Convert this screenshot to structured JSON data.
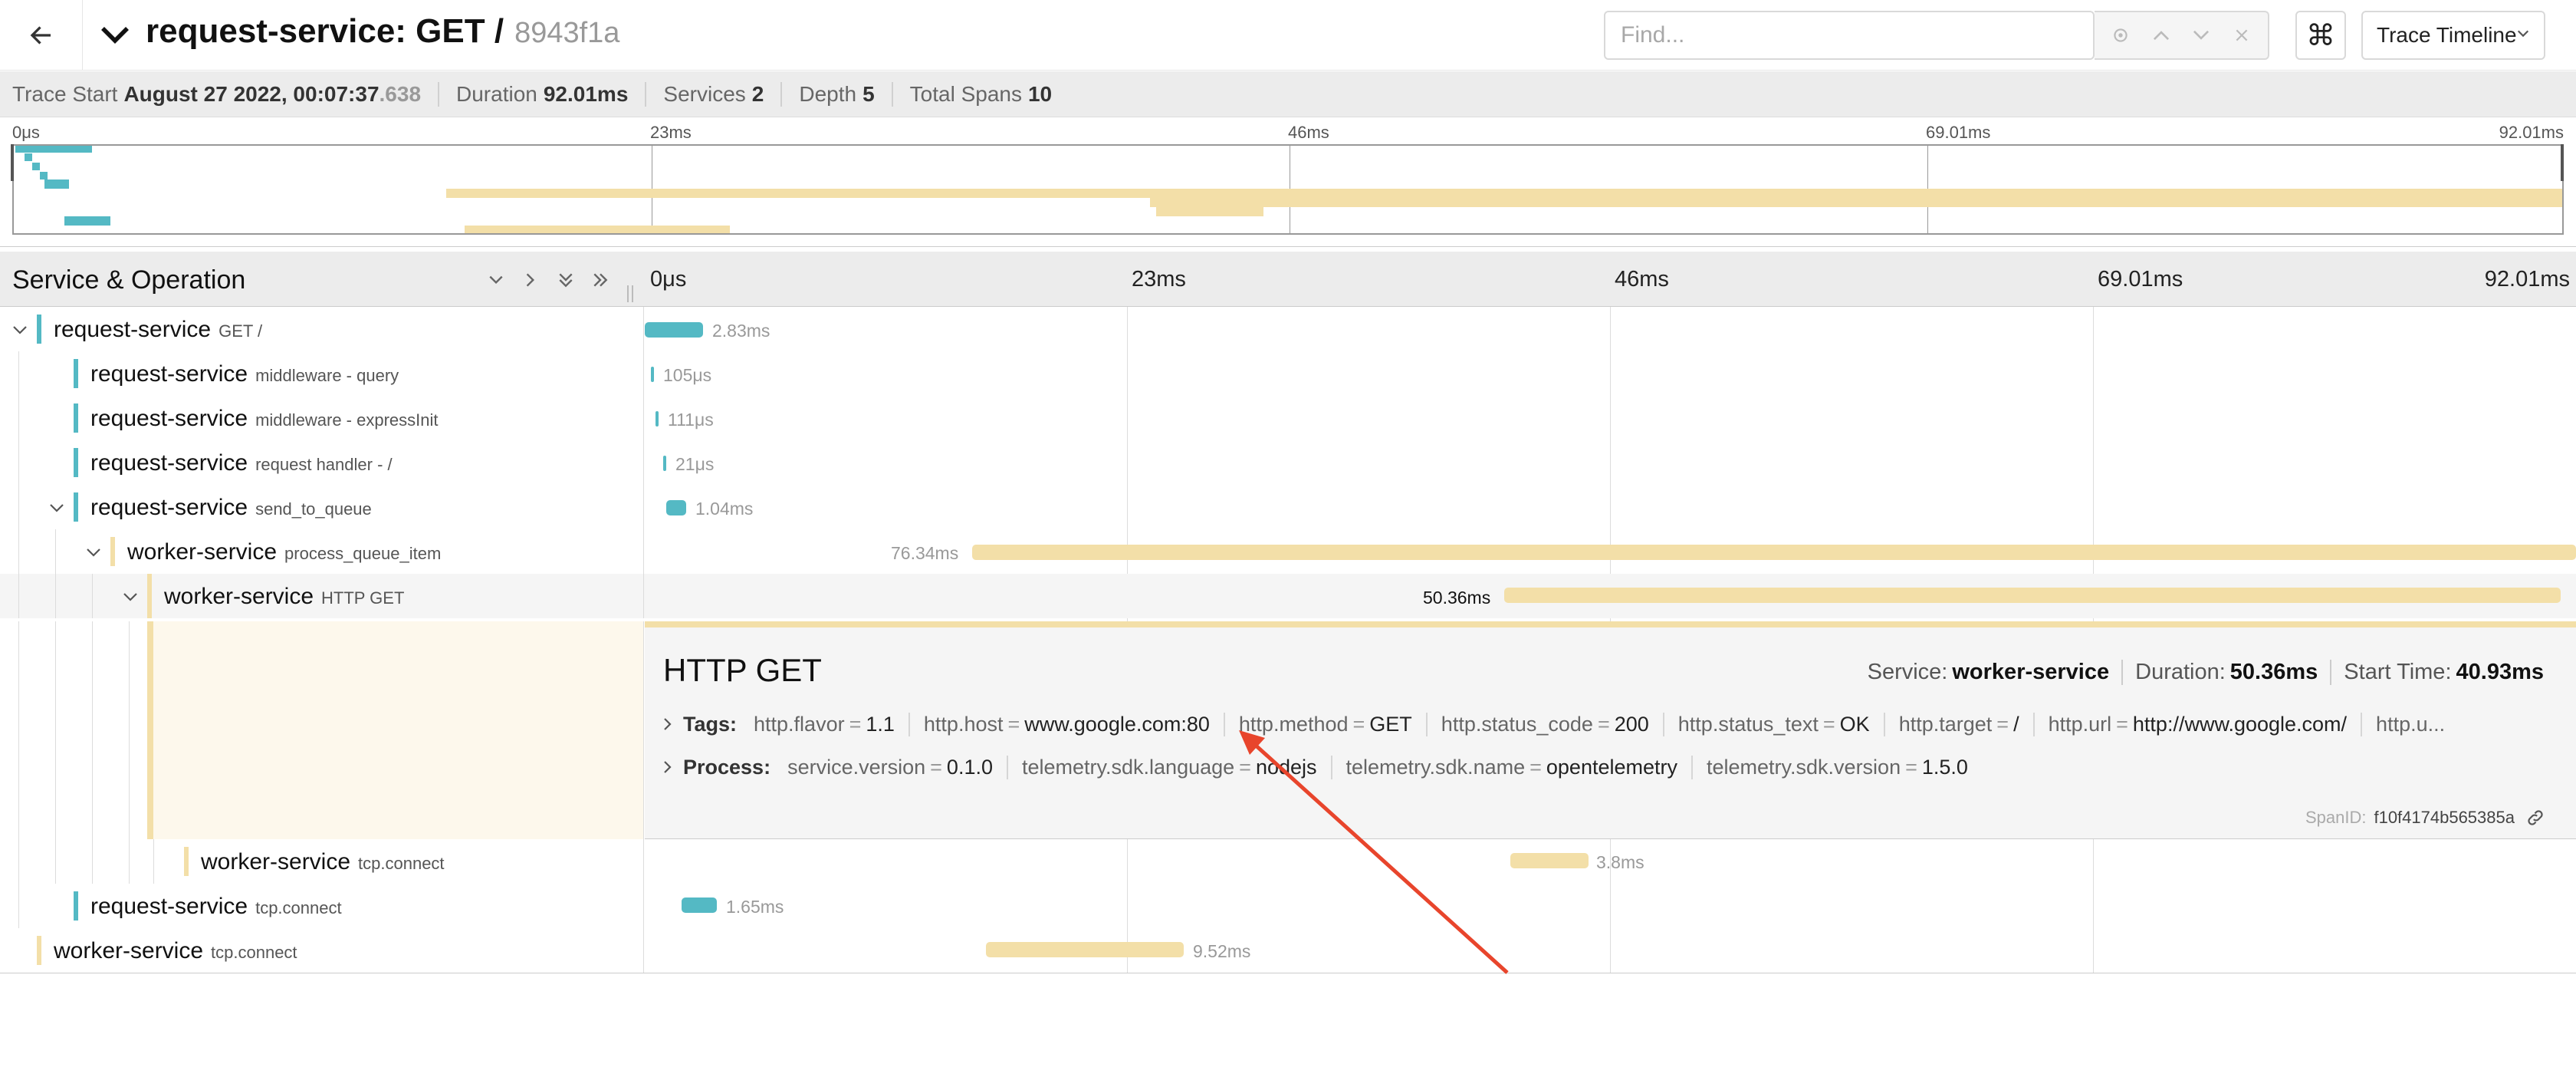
{
  "header": {
    "title": "request-service: GET /",
    "trace_id": "8943f1a",
    "find_placeholder": "Find...",
    "view_mode": "Trace Timeline",
    "keyboard_glyph": "⌘"
  },
  "summary": {
    "trace_start_label": "Trace Start",
    "trace_start_value": "August 27 2022, 00:07:37",
    "trace_start_ms": ".638",
    "duration_label": "Duration",
    "duration_value": "92.01ms",
    "services_label": "Services",
    "services_value": "2",
    "depth_label": "Depth",
    "depth_value": "5",
    "total_spans_label": "Total Spans",
    "total_spans_value": "10"
  },
  "ticks": [
    "0μs",
    "23ms",
    "46ms",
    "69.01ms",
    "92.01ms"
  ],
  "timeline_header": {
    "title": "Service & Operation"
  },
  "colors": {
    "request_service": "#54b9c4",
    "worker_service": "#f3dfa8",
    "arrow": "#e8452c"
  },
  "spans": [
    {
      "service": "request-service",
      "operation": "GET /",
      "duration": "2.83ms"
    },
    {
      "service": "request-service",
      "operation": "middleware - query",
      "duration": "105μs"
    },
    {
      "service": "request-service",
      "operation": "middleware - expressInit",
      "duration": "111μs"
    },
    {
      "service": "request-service",
      "operation": "request handler - /",
      "duration": "21μs"
    },
    {
      "service": "request-service",
      "operation": "send_to_queue",
      "duration": "1.04ms"
    },
    {
      "service": "worker-service",
      "operation": "process_queue_item",
      "duration": "76.34ms"
    },
    {
      "service": "worker-service",
      "operation": "HTTP GET",
      "duration": "50.36ms"
    },
    {
      "service": "worker-service",
      "operation": "tcp.connect",
      "duration": "3.8ms"
    },
    {
      "service": "request-service",
      "operation": "tcp.connect",
      "duration": "1.65ms"
    },
    {
      "service": "worker-service",
      "operation": "tcp.connect",
      "duration": "9.52ms"
    }
  ],
  "detail": {
    "title": "HTTP GET",
    "service_label": "Service:",
    "service_value": "worker-service",
    "duration_label": "Duration:",
    "duration_value": "50.36ms",
    "start_label": "Start Time:",
    "start_value": "40.93ms",
    "tags_label": "Tags:",
    "tags": [
      {
        "k": "http.flavor",
        "v": "1.1"
      },
      {
        "k": "http.host",
        "v": "www.google.com:80"
      },
      {
        "k": "http.method",
        "v": "GET"
      },
      {
        "k": "http.status_code",
        "v": "200"
      },
      {
        "k": "http.status_text",
        "v": "OK"
      },
      {
        "k": "http.target",
        "v": "/"
      },
      {
        "k": "http.url",
        "v": "http://www.google.com/"
      }
    ],
    "tags_overflow": "http.u...",
    "process_label": "Process:",
    "process": [
      {
        "k": "service.version",
        "v": "0.1.0"
      },
      {
        "k": "telemetry.sdk.language",
        "v": "nodejs"
      },
      {
        "k": "telemetry.sdk.name",
        "v": "opentelemetry"
      },
      {
        "k": "telemetry.sdk.version",
        "v": "1.5.0"
      }
    ],
    "span_id_label": "SpanID:",
    "span_id": "f10f4174b565385a"
  }
}
